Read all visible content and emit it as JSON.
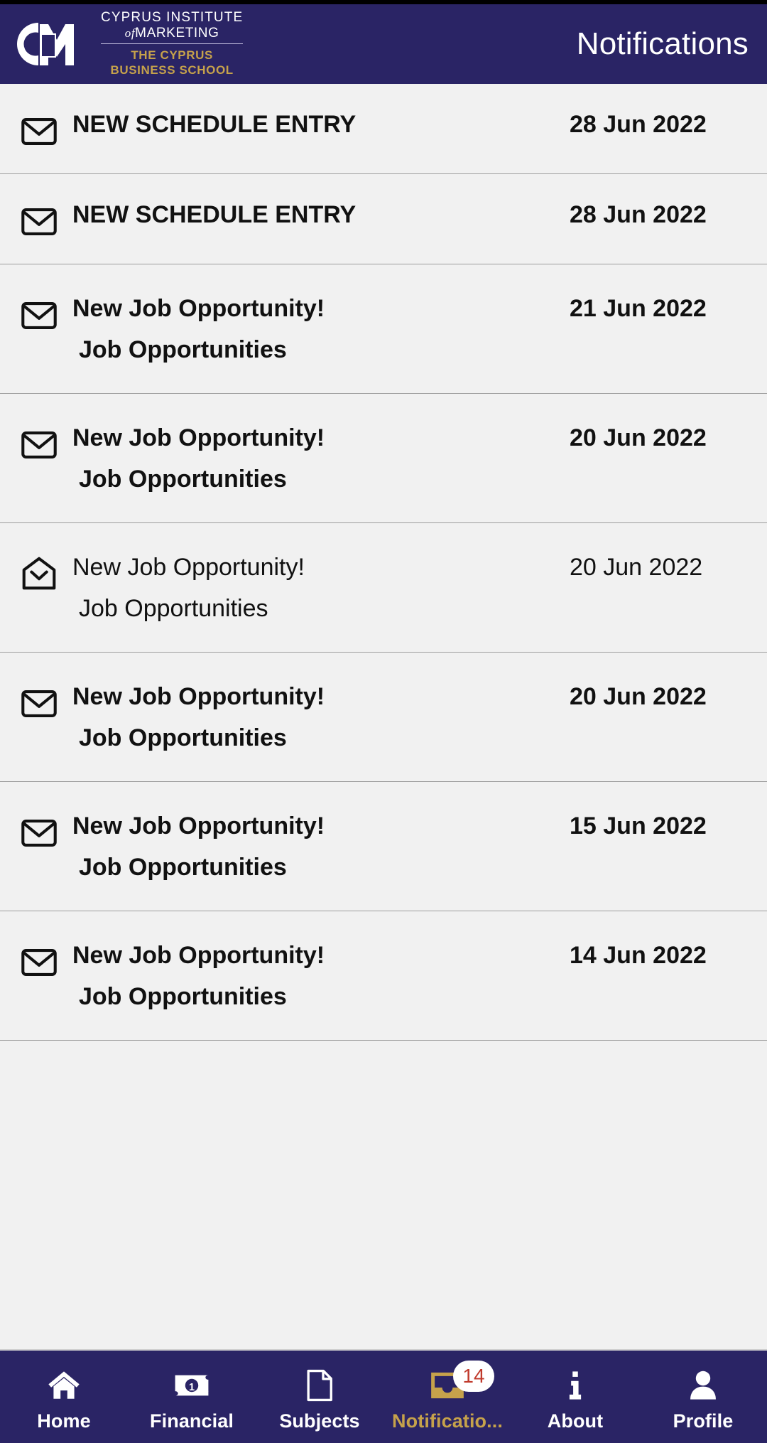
{
  "colors": {
    "header_navy": "#2a2465",
    "accent_gold": "#c6a24b",
    "list_bg": "#f1f1f1",
    "divider": "#9e9e9e",
    "badge_text_red": "#c0392b",
    "text_primary": "#111111"
  },
  "header": {
    "title": "Notifications",
    "logo": {
      "icon": "cim-monogram-logo",
      "line1": "CYPRUS INSTITUTE",
      "line2_italic": "of",
      "line2": "MARKETING",
      "tagline_line1": "THE CYPRUS",
      "tagline_line2": "BUSINESS SCHOOL"
    }
  },
  "notifications": [
    {
      "icon": "closed-envelope-icon",
      "read": false,
      "title": "NEW SCHEDULE ENTRY",
      "subtitle": "",
      "date": "28 Jun 2022"
    },
    {
      "icon": "closed-envelope-icon",
      "read": false,
      "title": "NEW SCHEDULE ENTRY",
      "subtitle": "",
      "date": "28 Jun 2022"
    },
    {
      "icon": "closed-envelope-icon",
      "read": false,
      "title": "New Job Opportunity!",
      "subtitle": "Job Opportunities",
      "date": "21 Jun 2022"
    },
    {
      "icon": "closed-envelope-icon",
      "read": false,
      "title": "New Job Opportunity!",
      "subtitle": "Job Opportunities",
      "date": "20 Jun 2022"
    },
    {
      "icon": "open-envelope-icon",
      "read": true,
      "title": "New Job Opportunity!",
      "subtitle": "Job Opportunities",
      "date": "20 Jun 2022"
    },
    {
      "icon": "closed-envelope-icon",
      "read": false,
      "title": "New Job Opportunity!",
      "subtitle": "Job Opportunities",
      "date": "20 Jun 2022"
    },
    {
      "icon": "closed-envelope-icon",
      "read": false,
      "title": "New Job Opportunity!",
      "subtitle": "Job Opportunities",
      "date": "15 Jun 2022"
    },
    {
      "icon": "closed-envelope-icon",
      "read": false,
      "title": "New Job Opportunity!",
      "subtitle": "Job Opportunities",
      "date": "14 Jun 2022"
    }
  ],
  "bottom_nav": {
    "active_index": 3,
    "items": [
      {
        "label": "Home",
        "icon": "home-icon"
      },
      {
        "label": "Financial",
        "icon": "banknote-icon"
      },
      {
        "label": "Subjects",
        "icon": "document-icon"
      },
      {
        "label": "Notificatio...",
        "icon": "notification-envelope-icon",
        "badge": "14"
      },
      {
        "label": "About",
        "icon": "info-icon"
      },
      {
        "label": "Profile",
        "icon": "person-icon"
      }
    ]
  }
}
